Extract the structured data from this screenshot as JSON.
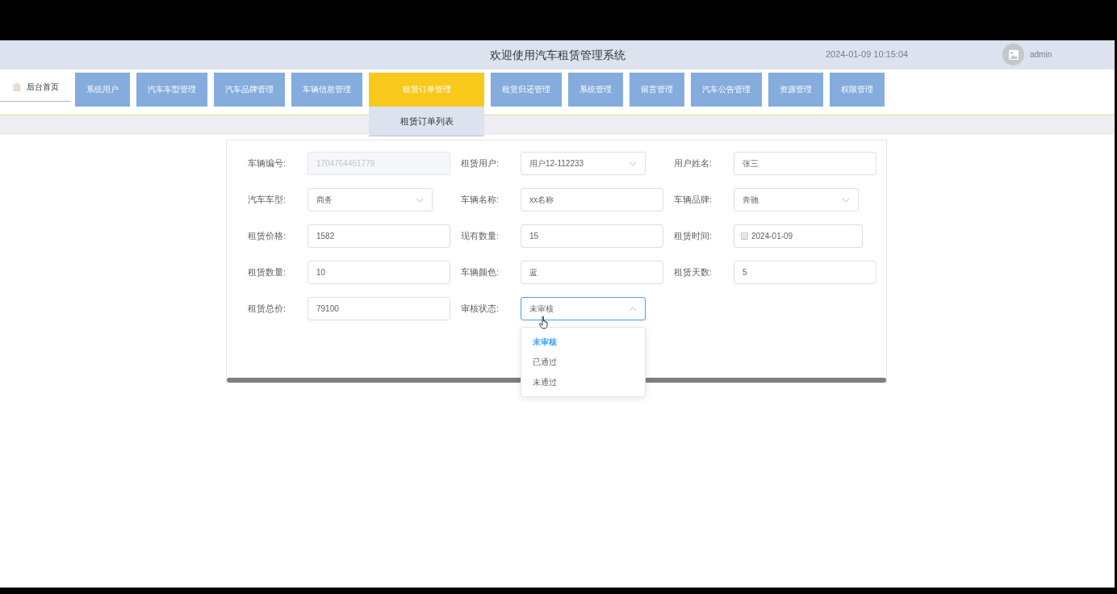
{
  "header": {
    "title": "欢迎使用汽车租赁管理系统",
    "datetime": "2024-01-09 10:15:04",
    "user": "admin"
  },
  "nav": {
    "home": "后台首页",
    "items": [
      {
        "label": "系统用户",
        "selected": false
      },
      {
        "label": "汽车车型管理",
        "selected": false
      },
      {
        "label": "汽车品牌管理",
        "selected": false
      },
      {
        "label": "车辆信息管理",
        "selected": false
      },
      {
        "label": "租赁订单管理",
        "selected": true,
        "submenu": [
          "租赁订单列表"
        ]
      },
      {
        "label": "租赁归还管理",
        "selected": false
      },
      {
        "label": "系统管理",
        "selected": false
      },
      {
        "label": "留言管理",
        "selected": false
      },
      {
        "label": "汽车公告管理",
        "selected": false
      },
      {
        "label": "资源管理",
        "selected": false
      },
      {
        "label": "权限管理",
        "selected": false
      }
    ]
  },
  "form": {
    "fields": [
      {
        "label": "车辆编号:",
        "kind": "text",
        "value": "1704764451779",
        "disabled": true
      },
      {
        "label": "租赁用户:",
        "kind": "select",
        "value": "用户12-112233",
        "disabled": false,
        "open": false
      },
      {
        "label": "用户姓名:",
        "kind": "text",
        "value": "张三",
        "disabled": false
      },
      {
        "label": "汽车车型:",
        "kind": "select",
        "value": "商务",
        "disabled": false,
        "open": false
      },
      {
        "label": "车辆名称:",
        "kind": "text",
        "value": "xx名称",
        "disabled": false
      },
      {
        "label": "车辆品牌:",
        "kind": "select",
        "value": "奔驰",
        "disabled": false,
        "open": false
      },
      {
        "label": "租赁价格:",
        "kind": "text",
        "value": "1582",
        "disabled": false
      },
      {
        "label": "现有数量:",
        "kind": "text",
        "value": "15",
        "disabled": false
      },
      {
        "label": "租赁时间:",
        "kind": "date",
        "value": "2024-01-09",
        "disabled": false
      },
      {
        "label": "租赁数量:",
        "kind": "text",
        "value": "10",
        "disabled": false
      },
      {
        "label": "车辆颜色:",
        "kind": "text",
        "value": "蓝",
        "disabled": false
      },
      {
        "label": "租赁天数:",
        "kind": "text",
        "value": "5",
        "disabled": false
      },
      {
        "label": "租赁总价:",
        "kind": "text",
        "value": "79100",
        "disabled": false
      },
      {
        "label": "审核状态:",
        "kind": "select",
        "value": "未审核",
        "disabled": false,
        "open": true,
        "options": [
          {
            "label": "未审核",
            "selected": true
          },
          {
            "label": "已通过",
            "selected": false
          },
          {
            "label": "未通过",
            "selected": false
          }
        ]
      }
    ]
  }
}
